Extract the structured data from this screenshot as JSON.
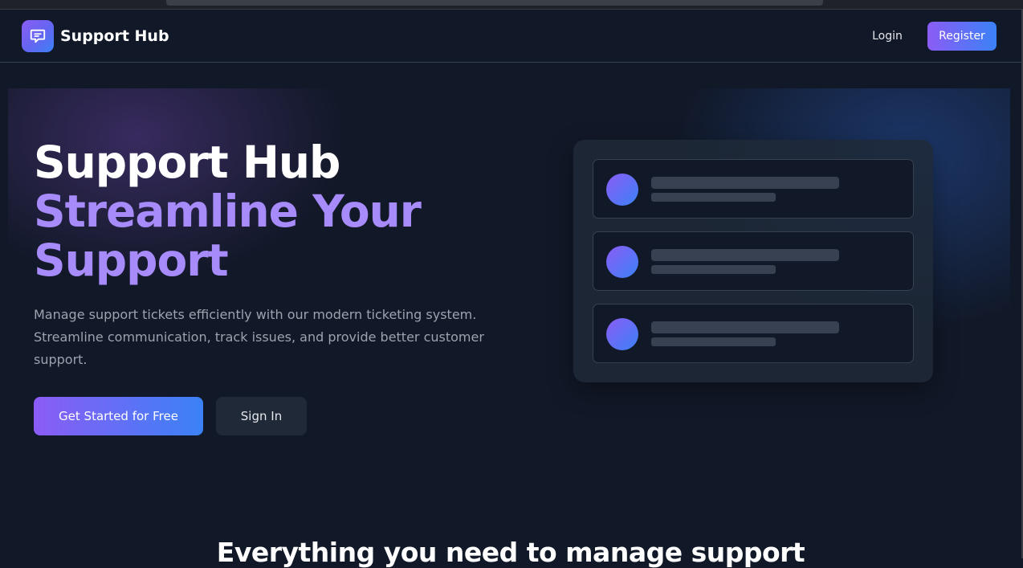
{
  "navbar": {
    "brand_name": "Support Hub",
    "logo_icon": "chat-bubble-icon",
    "login_label": "Login",
    "register_label": "Register"
  },
  "hero": {
    "title_line1": "Support Hub",
    "title_line2": "Streamline Your Support",
    "description": "Manage support tickets efficiently with our modern ticketing system. Streamline communication, track issues, and provide better customer support.",
    "primary_cta": "Get Started for Free",
    "secondary_cta": "Sign In"
  },
  "features": {
    "heading": "Everything you need to manage support"
  },
  "colors": {
    "background": "#111827",
    "accent_purple": "#8b5cf6",
    "accent_blue": "#3b82f6",
    "title_accent": "#a78bfa",
    "muted_text": "#9ca3af",
    "card": "#1f2937"
  }
}
